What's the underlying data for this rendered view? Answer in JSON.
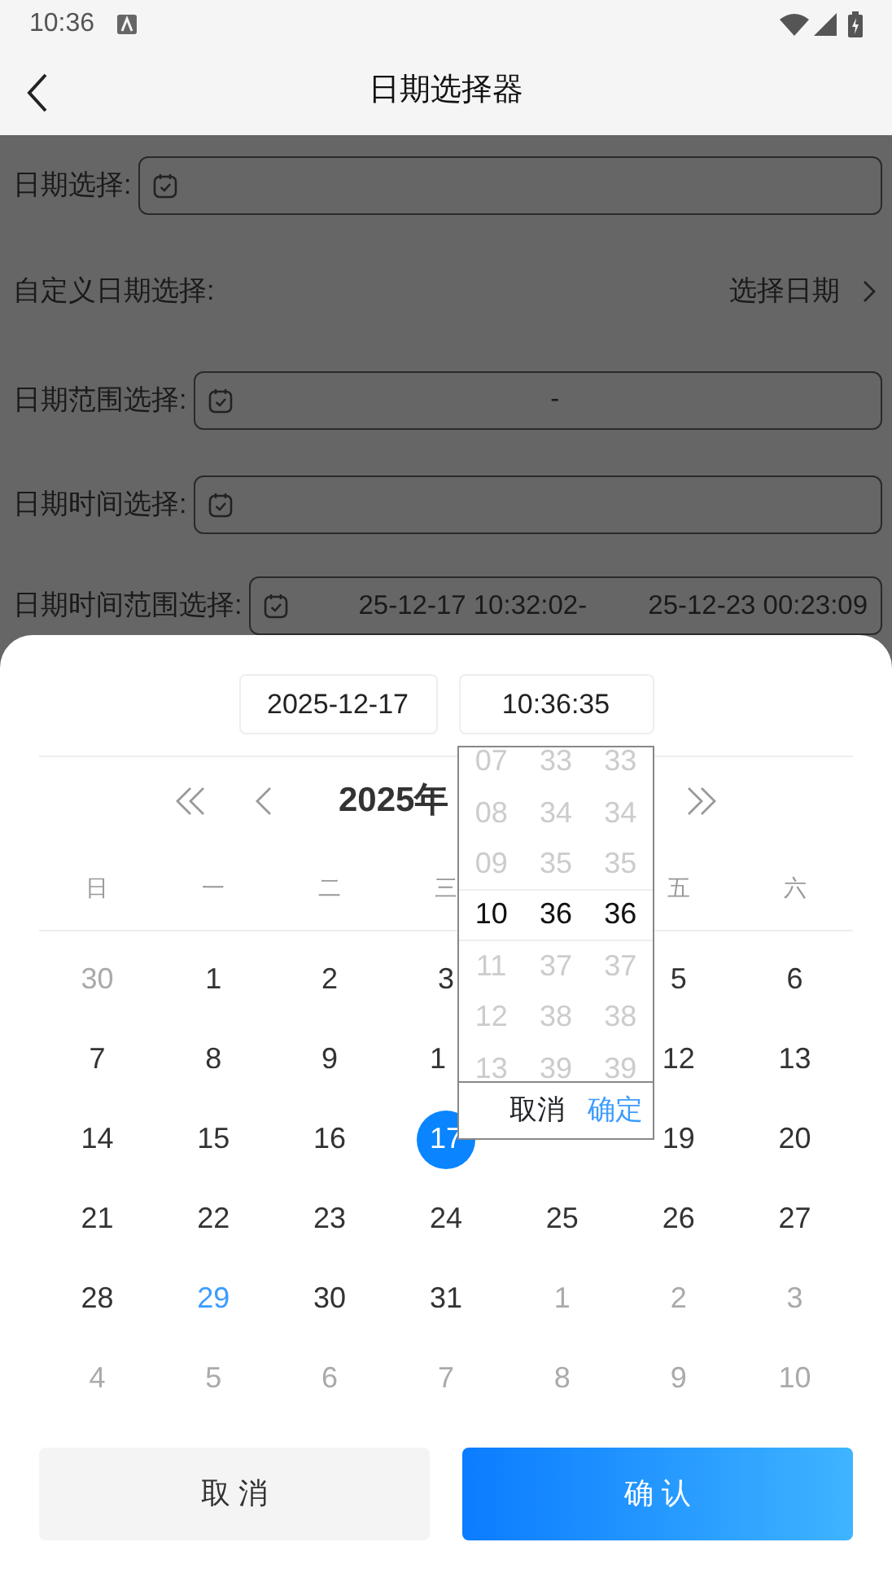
{
  "status_bar": {
    "time": "10:36"
  },
  "header": {
    "title": "日期选择器"
  },
  "form": [
    {
      "kind": "input",
      "label": "日期选择:"
    },
    {
      "kind": "link",
      "label": "自定义日期选择:",
      "action": "选择日期"
    },
    {
      "kind": "range",
      "label": "日期范围选择:",
      "separator": "-"
    },
    {
      "kind": "input",
      "label": "日期时间选择:"
    },
    {
      "kind": "range",
      "label": "日期时间范围选择:",
      "start": "25-12-17 10:32:02",
      "separator": "-",
      "end": "25-12-23 00:23:09"
    }
  ],
  "picker": {
    "date_tab": "2025-12-17",
    "time_tab": "10:36:35",
    "month_title": "2025年",
    "weekdays": [
      {
        "kind": "label",
        "text": "日"
      },
      {
        "kind": "label",
        "text": "一"
      },
      {
        "kind": "label",
        "text": "二"
      },
      {
        "kind": "label",
        "text": "三"
      },
      {
        "kind": "blank"
      },
      {
        "kind": "label",
        "text": "五"
      },
      {
        "kind": "label",
        "text": "六"
      }
    ],
    "weeks": [
      [
        {
          "day": "30",
          "muted": true,
          "today": false,
          "selected": false
        },
        {
          "day": "1",
          "muted": false,
          "today": false,
          "selected": false
        },
        {
          "day": "2",
          "muted": false,
          "today": false,
          "selected": false
        },
        {
          "day": "3",
          "muted": false,
          "today": false,
          "selected": false
        },
        {
          "kind": "blank"
        },
        {
          "day": "5",
          "muted": false,
          "today": false,
          "selected": false
        },
        {
          "day": "6",
          "muted": false,
          "today": false,
          "selected": false
        }
      ],
      [
        {
          "day": "7",
          "muted": false,
          "today": false,
          "selected": false
        },
        {
          "day": "8",
          "muted": false,
          "today": false,
          "selected": false
        },
        {
          "day": "9",
          "muted": false,
          "today": false,
          "selected": false
        },
        {
          "kind": "clipped",
          "day": "1",
          "muted": false,
          "today": false,
          "selected": false
        },
        {
          "kind": "blank"
        },
        {
          "day": "12",
          "muted": false,
          "today": false,
          "selected": false
        },
        {
          "day": "13",
          "muted": false,
          "today": false,
          "selected": false
        }
      ],
      [
        {
          "day": "14",
          "muted": false,
          "today": false,
          "selected": false
        },
        {
          "day": "15",
          "muted": false,
          "today": false,
          "selected": false
        },
        {
          "day": "16",
          "muted": false,
          "today": false,
          "selected": false
        },
        {
          "day": "17",
          "muted": false,
          "today": false,
          "selected": true
        },
        {
          "kind": "blank"
        },
        {
          "day": "19",
          "muted": false,
          "today": false,
          "selected": false
        },
        {
          "day": "20",
          "muted": false,
          "today": false,
          "selected": false
        }
      ],
      [
        {
          "day": "21",
          "muted": false,
          "today": false,
          "selected": false
        },
        {
          "day": "22",
          "muted": false,
          "today": false,
          "selected": false
        },
        {
          "day": "23",
          "muted": false,
          "today": false,
          "selected": false
        },
        {
          "day": "24",
          "muted": false,
          "today": false,
          "selected": false
        },
        {
          "day": "25",
          "muted": false,
          "today": false,
          "selected": false
        },
        {
          "day": "26",
          "muted": false,
          "today": false,
          "selected": false
        },
        {
          "day": "27",
          "muted": false,
          "today": false,
          "selected": false
        }
      ],
      [
        {
          "day": "28",
          "muted": false,
          "today": false,
          "selected": false
        },
        {
          "day": "29",
          "muted": false,
          "today": true,
          "selected": false
        },
        {
          "day": "30",
          "muted": false,
          "today": false,
          "selected": false
        },
        {
          "day": "31",
          "muted": false,
          "today": false,
          "selected": false
        },
        {
          "day": "1",
          "muted": true,
          "today": false,
          "selected": false
        },
        {
          "day": "2",
          "muted": true,
          "today": false,
          "selected": false
        },
        {
          "day": "3",
          "muted": true,
          "today": false,
          "selected": false
        }
      ],
      [
        {
          "day": "4",
          "muted": true,
          "today": false,
          "selected": false
        },
        {
          "day": "5",
          "muted": true,
          "today": false,
          "selected": false
        },
        {
          "day": "6",
          "muted": true,
          "today": false,
          "selected": false
        },
        {
          "day": "7",
          "muted": true,
          "today": false,
          "selected": false
        },
        {
          "day": "8",
          "muted": true,
          "today": false,
          "selected": false
        },
        {
          "day": "9",
          "muted": true,
          "today": false,
          "selected": false
        },
        {
          "day": "10",
          "muted": true,
          "today": false,
          "selected": false
        }
      ]
    ],
    "time_columns": [
      [
        {
          "text": "07",
          "selected": false
        },
        {
          "text": "08",
          "selected": false
        },
        {
          "text": "09",
          "selected": false
        },
        {
          "text": "10",
          "selected": true
        },
        {
          "text": "11",
          "selected": false
        },
        {
          "text": "12",
          "selected": false
        },
        {
          "text": "13",
          "selected": false
        }
      ],
      [
        {
          "text": "33",
          "selected": false
        },
        {
          "text": "34",
          "selected": false
        },
        {
          "text": "35",
          "selected": false
        },
        {
          "text": "36",
          "selected": true
        },
        {
          "text": "37",
          "selected": false
        },
        {
          "text": "38",
          "selected": false
        },
        {
          "text": "39",
          "selected": false
        }
      ],
      [
        {
          "text": "33",
          "selected": false
        },
        {
          "text": "34",
          "selected": false
        },
        {
          "text": "35",
          "selected": false
        },
        {
          "text": "36",
          "selected": true
        },
        {
          "text": "37",
          "selected": false
        },
        {
          "text": "38",
          "selected": false
        },
        {
          "text": "39",
          "selected": false
        }
      ]
    ],
    "time_cancel": "取消",
    "time_confirm": "确定",
    "buttons": {
      "cancel": "取 消",
      "confirm": "确 认"
    }
  }
}
